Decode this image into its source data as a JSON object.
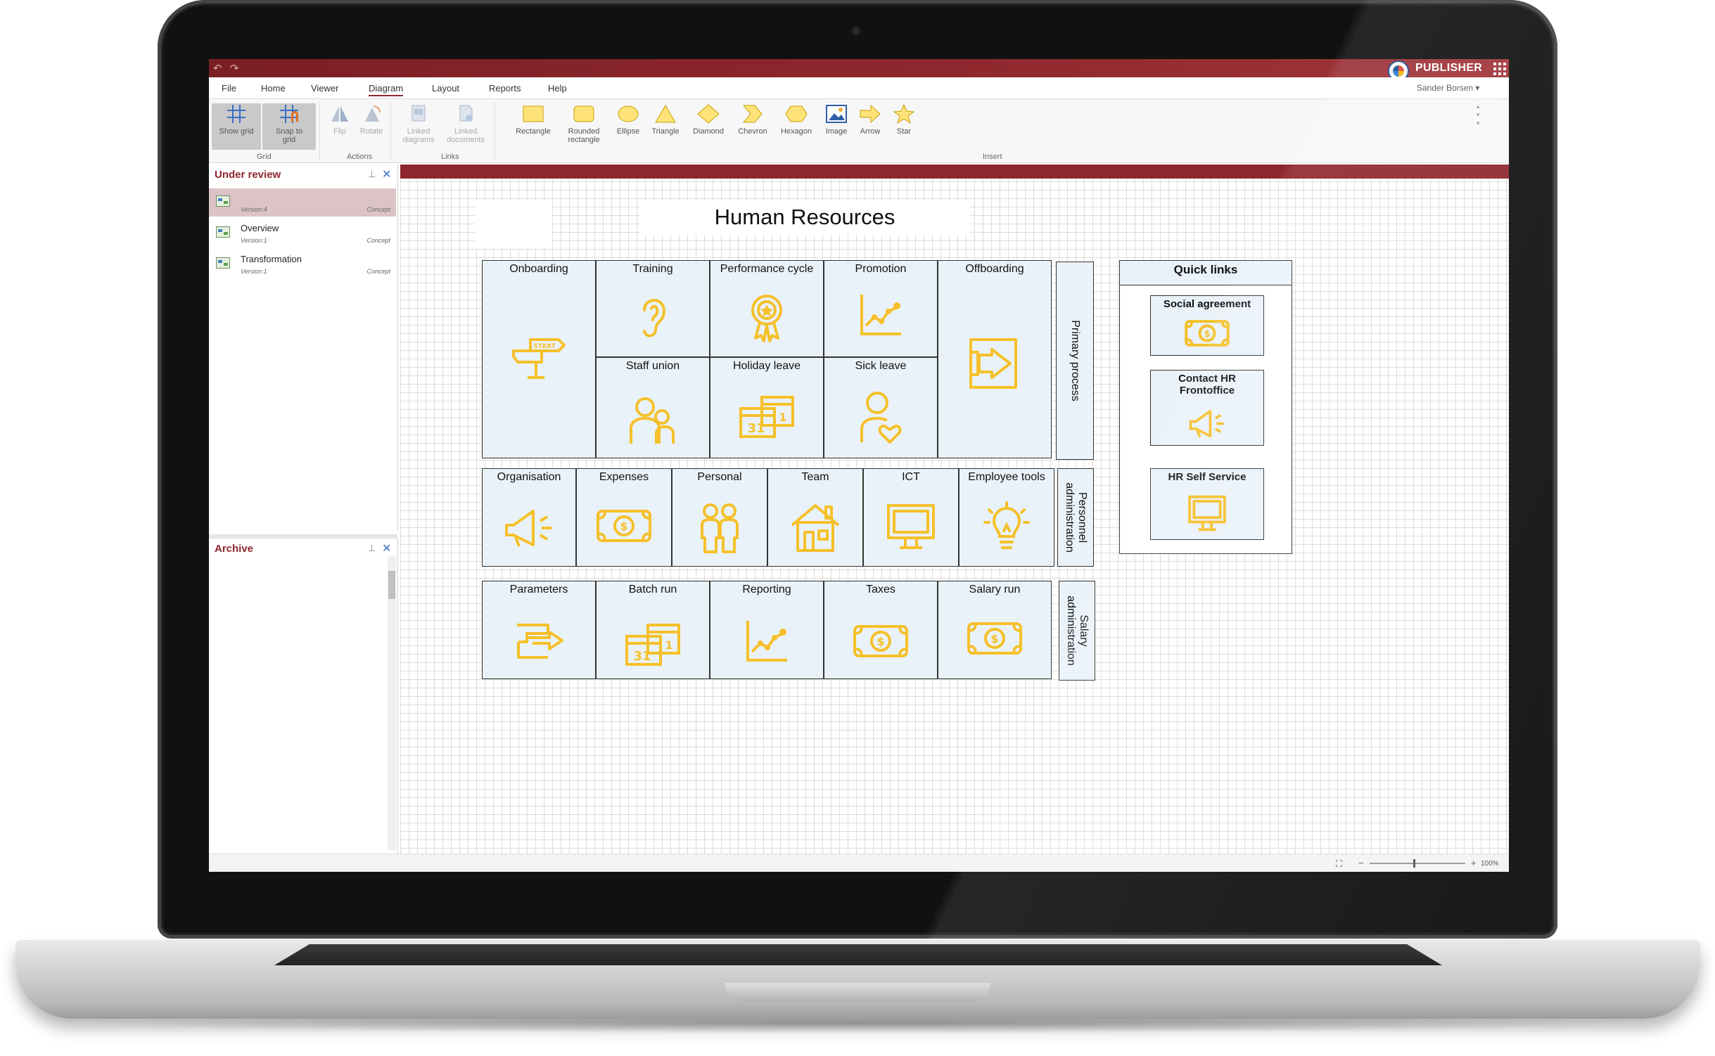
{
  "app": {
    "brand": "PUBLISHER",
    "user": "Sander Borsen ▾"
  },
  "menu": [
    "File",
    "Home",
    "Viewer",
    "Diagram",
    "Layout",
    "Reports",
    "Help"
  ],
  "ribbon": {
    "show_grid": "Show grid",
    "snap_to_grid_1": "Snap to",
    "snap_to_grid_2": "grid",
    "flip": "Flip",
    "rotate": "Rotate",
    "linked_diagrams_1": "Linked",
    "linked_diagrams_2": "diagrams",
    "linked_documents_1": "Linked",
    "linked_documents_2": "documents",
    "rectangle": "Rectangle",
    "rounded_1": "Rounded",
    "rounded_2": "rectangle",
    "ellipse": "Ellipse",
    "triangle": "Triangle",
    "diamond": "Diamond",
    "chevron": "Chevron",
    "hexagon": "Hexagon",
    "image": "Image",
    "arrow": "Arrow",
    "star": "Star",
    "groups": {
      "grid": "Grid",
      "actions": "Actions",
      "links": "Links",
      "insert": "Insert"
    }
  },
  "under_review": {
    "title": "Under review",
    "items": [
      {
        "name": "",
        "version": "Version:4",
        "status": "Concept"
      },
      {
        "name": "Overview",
        "version": "Version:1",
        "status": "Concept"
      },
      {
        "name": "Transformation",
        "version": "Version:1",
        "status": "Concept"
      }
    ]
  },
  "archive": {
    "title": "Archive"
  },
  "status": {
    "zoom": "100%"
  },
  "diagram": {
    "title": "Human Resources",
    "primary": {
      "lane": "Primary process",
      "onboarding": "Onboarding",
      "training": "Training",
      "performance": "Performance cycle",
      "promotion": "Promotion",
      "offboarding": "Offboarding",
      "staff_union": "Staff union",
      "holiday_leave": "Holiday leave",
      "sick_leave": "Sick leave"
    },
    "personnel": {
      "lane_1": "Personnel",
      "lane_2": "administration",
      "items": [
        "Organisation",
        "Expenses",
        "Personal",
        "Team",
        "ICT",
        "Employee tools"
      ]
    },
    "salary": {
      "lane_1": "Salary",
      "lane_2": "administration",
      "items": [
        "Parameters",
        "Batch run",
        "Reporting",
        "Taxes",
        "Salary run"
      ]
    },
    "quick_links": {
      "title": "Quick links",
      "social": "Social agreement",
      "contact_1": "Contact HR",
      "contact_2": "Frontoffice",
      "self_service": "HR Self Service"
    }
  },
  "colors": {
    "accent": "#8e272d",
    "icon": "#f5c02a",
    "box_fill": "#eaf2f9"
  }
}
